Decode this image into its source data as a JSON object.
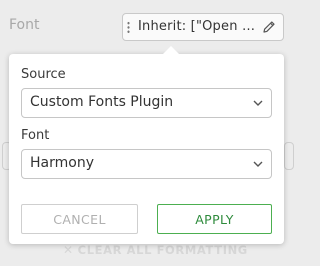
{
  "background": {
    "font_label": "Font",
    "font_field_value": "Inherit: [\"Open Sans\"]",
    "clear_all_label": "CLEAR ALL FORMATTING"
  },
  "popover": {
    "source_label": "Source",
    "source_value": "Custom Fonts Plugin",
    "font_label": "Font",
    "font_value": "Harmony",
    "cancel_label": "CANCEL",
    "apply_label": "APPLY"
  },
  "icons": {
    "drag": "drag-handle-icon",
    "edit": "pencil-icon",
    "dropdown": "chevron-down-icon",
    "clear": "x-icon"
  },
  "colors": {
    "apply_accent": "#4caf50",
    "background": "#ececec"
  }
}
